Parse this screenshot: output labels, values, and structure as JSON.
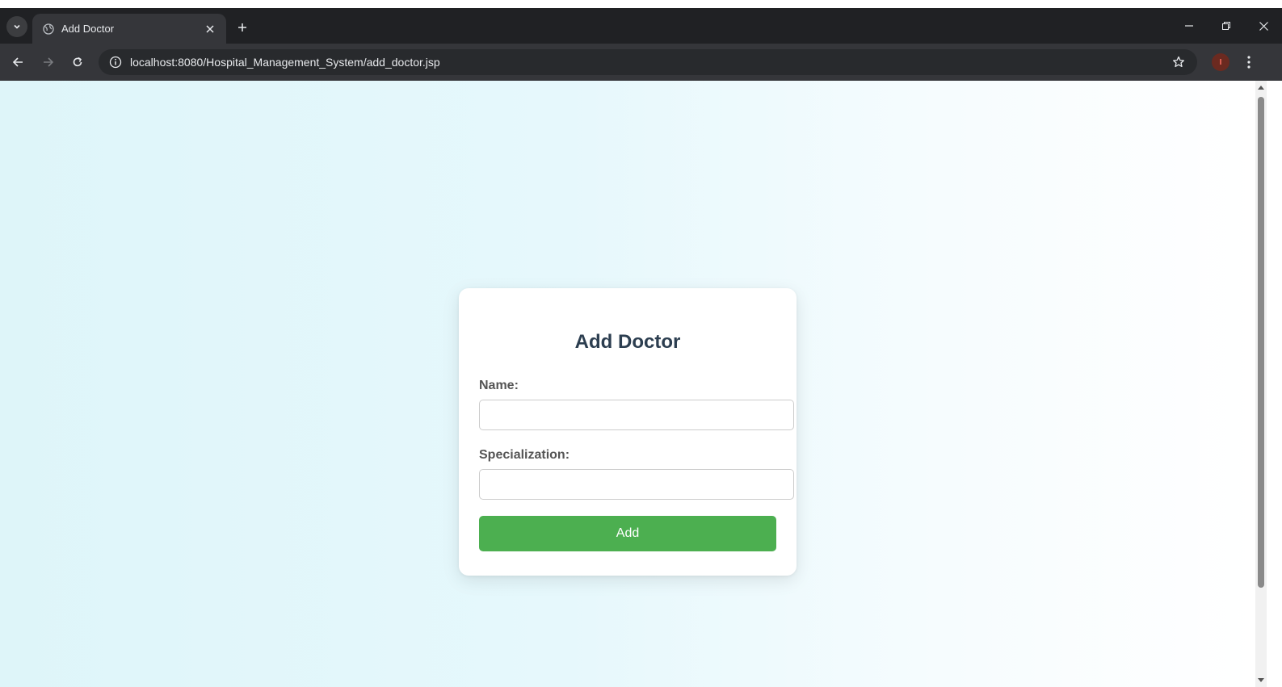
{
  "browser": {
    "tab": {
      "title": "Add Doctor"
    },
    "address_bar": {
      "url": "localhost:8080/Hospital_Management_System/add_doctor.jsp"
    },
    "profile_initial": "I"
  },
  "form": {
    "title": "Add Doctor",
    "name_label": "Name:",
    "name_value": "",
    "specialization_label": "Specialization:",
    "specialization_value": "",
    "submit_label": "Add"
  },
  "colors": {
    "accent_button": "#4caf50",
    "title_text": "#2c3e50",
    "browser_frame": "#202124"
  }
}
